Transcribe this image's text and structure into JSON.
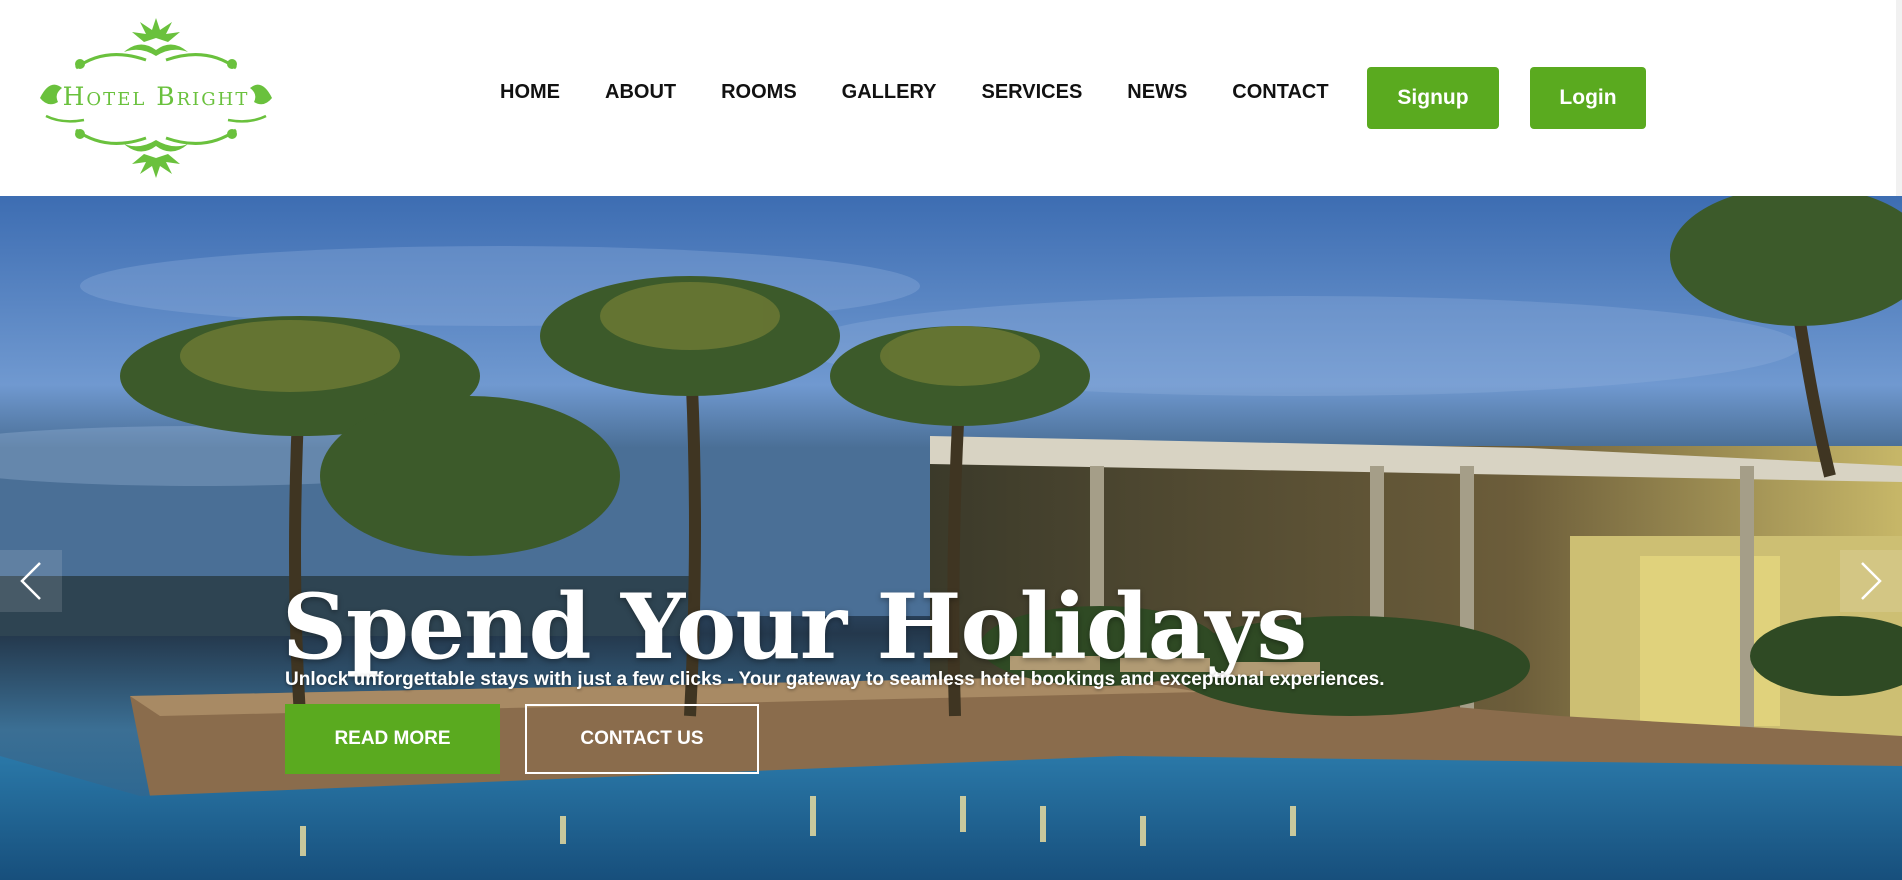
{
  "brand": {
    "logo_text": "Hotel Bright",
    "accent_color": "#5aaa1f",
    "logo_color": "#6ac13d"
  },
  "nav": {
    "items": [
      "HOME",
      "ABOUT",
      "ROOMS",
      "GALLERY",
      "SERVICES",
      "NEWS",
      "CONTACT"
    ]
  },
  "auth": {
    "signup_label": "Signup",
    "login_label": "Login"
  },
  "hero": {
    "title": "Spend Your Holidays",
    "subtitle": "Unlock unforgettable stays with just a few clicks - Your gateway to seamless hotel bookings and exceptional experiences.",
    "read_more_label": "READ MORE",
    "contact_label": "CONTACT US",
    "prev_icon": "chevron-left-icon",
    "next_icon": "chevron-right-icon"
  }
}
